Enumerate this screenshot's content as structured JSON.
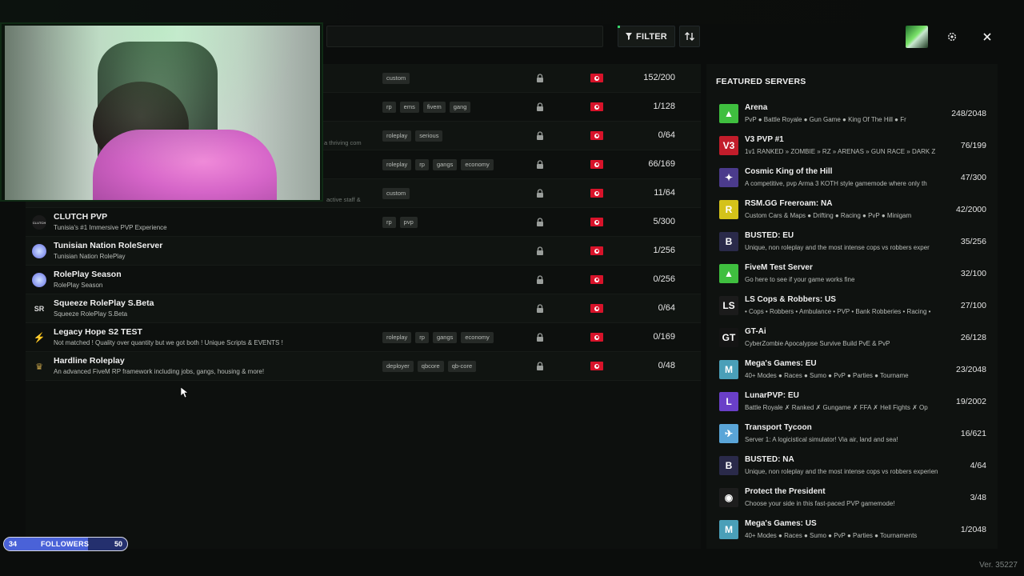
{
  "toolbar": {
    "filter_label": "FILTER",
    "sort_icon": "sort-arrows-icon",
    "settings_icon": "gear-icon",
    "close_icon": "close-icon"
  },
  "server_list": [
    {
      "name": "",
      "desc": "",
      "tags": [
        "custom"
      ],
      "players": "152/200"
    },
    {
      "name": "",
      "desc": "",
      "tags": [
        "rp",
        "ems",
        "fivem",
        "gang"
      ],
      "players": "1/128"
    },
    {
      "name": "",
      "desc": "",
      "tags": [
        "roleplay",
        "serious"
      ],
      "players": "0/64"
    },
    {
      "name": "",
      "desc": "",
      "tags": [
        "roleplay",
        "rp",
        "gangs",
        "economy"
      ],
      "players": "66/169"
    },
    {
      "name": "",
      "desc": "",
      "tags": [
        "custom"
      ],
      "players": "11/64"
    },
    {
      "name": "CLUTCH PVP",
      "desc": "Tunisia's #1 Immersive PVP Experience",
      "tags": [
        "rp",
        "pvp"
      ],
      "players": "5/300"
    },
    {
      "name": "Tunisian Nation RoleServer",
      "desc": "Tunisian Nation RolePlay",
      "tags": [],
      "players": "1/256"
    },
    {
      "name": "RolePlay Season",
      "desc": "RolePlay Season",
      "tags": [],
      "players": "0/256"
    },
    {
      "name": "Squeeze RolePlay S.Beta",
      "desc": "Squeeze RolePlay S.Beta",
      "tags": [],
      "players": "0/64"
    },
    {
      "name": "Legacy Hope S2 TEST",
      "desc": "Not matched ! Quality over quantity but we got both ! Unique Scripts & EVENTS !",
      "tags": [
        "roleplay",
        "rp",
        "gangs",
        "economy"
      ],
      "players": "0/169"
    },
    {
      "name": "Hardline Roleplay",
      "desc": "An advanced FiveM RP framework including jobs, gangs, housing & more!",
      "tags": [
        "deployer",
        "qbcore",
        "qb-core"
      ],
      "players": "0/48"
    }
  ],
  "ghost_texts": {
    "t1": "a thriving com",
    "t2": "active staff &"
  },
  "featured": {
    "title": "FEATURED SERVERS",
    "servers": [
      {
        "name": "Arena",
        "desc": "PvP ● Battle Royale ● Gun Game ● King Of The Hill ● Fr",
        "players": "248/2048",
        "color": "#3fbf3f",
        "glyph": "▲"
      },
      {
        "name": "V3 PVP #1",
        "desc": "1v1 RANKED » ZOMBIE » RZ » ARENAS » GUN RACE » DARK Z",
        "players": "76/199",
        "color": "#c21d2b",
        "glyph": "V3"
      },
      {
        "name": "Cosmic King of the Hill",
        "desc": "A competitive, pvp Arma 3 KOTH style gamemode where only th",
        "players": "47/300",
        "color": "#4b3b8c",
        "glyph": "✦"
      },
      {
        "name": "RSM.GG Freeroam: NA",
        "desc": "Custom Cars & Maps ● Drifting ● Racing ● PvP ● Minigam",
        "players": "42/2000",
        "color": "#d4c21a",
        "glyph": "R"
      },
      {
        "name": "BUSTED: EU",
        "desc": "Unique, non roleplay and the most intense cops vs robbers exper",
        "players": "35/256",
        "color": "#2a2a4a",
        "glyph": "B"
      },
      {
        "name": "FiveM Test Server",
        "desc": "Go here to see if your game works fine",
        "players": "32/100",
        "color": "#3fbf3f",
        "glyph": "▲"
      },
      {
        "name": "LS Cops & Robbers: US",
        "desc": "• Cops • Robbers • Ambulance • PVP • Bank Robberies • Racing •",
        "players": "27/100",
        "color": "#1b1b1b",
        "glyph": "LS"
      },
      {
        "name": "GT-Ai",
        "desc": "CyberZombie Apocalypse Survive Build PvE & PvP",
        "players": "26/128",
        "color": "#141414",
        "glyph": "GT"
      },
      {
        "name": "Mega's Games: EU",
        "desc": "40+ Modes ● Races ● Sumo ● PvP ● Parties ● Tourname",
        "players": "23/2048",
        "color": "#4a9fb8",
        "glyph": "M"
      },
      {
        "name": "LunarPVP: EU",
        "desc": "Battle Royale ✗ Ranked ✗ Gungame ✗ FFA ✗ Hell Fights ✗ Op",
        "players": "19/2002",
        "color": "#6a3fc8",
        "glyph": "L"
      },
      {
        "name": "Transport Tycoon",
        "desc": "Server 1: A logicistical simulator! Via air, land and sea!",
        "players": "16/621",
        "color": "#5aa5d8",
        "glyph": "✈"
      },
      {
        "name": "BUSTED: NA",
        "desc": "Unique, non roleplay and the most intense cops vs robbers experien",
        "players": "4/64",
        "color": "#2a2a4a",
        "glyph": "B"
      },
      {
        "name": "Protect the President",
        "desc": "Choose your side in this fast-paced PVP gamemode!",
        "players": "3/48",
        "color": "#1d1d1d",
        "glyph": "◉"
      },
      {
        "name": "Mega's Games: US",
        "desc": "40+ Modes ● Races ● Sumo ● PvP ● Parties ● Tournaments",
        "players": "1/2048",
        "color": "#4a9fb8",
        "glyph": "M"
      }
    ]
  },
  "followers": {
    "current": "34",
    "label": "FOLLOWERS",
    "goal": "50",
    "progress": 0.68
  },
  "version": "Ver. 35227",
  "colors": {
    "accent": "#36d46b",
    "flag_red": "#d8132a",
    "follower_bar": "#4a62d8"
  }
}
